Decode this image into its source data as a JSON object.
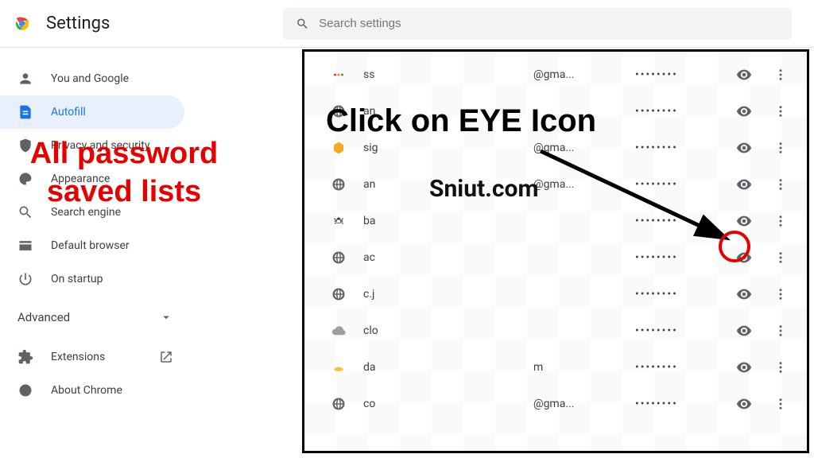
{
  "header": {
    "title": "Settings",
    "search_placeholder": "Search settings"
  },
  "sidebar": {
    "items": [
      {
        "label": "You and Google"
      },
      {
        "label": "Autofill"
      },
      {
        "label": "Privacy and security"
      },
      {
        "label": "Appearance"
      },
      {
        "label": "Search engine"
      },
      {
        "label": "Default browser"
      },
      {
        "label": "On startup"
      }
    ],
    "advanced": "Advanced",
    "extensions": "Extensions",
    "about": "About Chrome"
  },
  "passwords": [
    {
      "site": "ss",
      "user": "@gma...",
      "mask": "••••••••"
    },
    {
      "site": "an",
      "user": "",
      "mask": "••••••••"
    },
    {
      "site": "sig",
      "user": "@gma...",
      "mask": "••••••••"
    },
    {
      "site": "an",
      "user": "@gma...",
      "mask": "••••••••"
    },
    {
      "site": "ba",
      "user": "",
      "mask": "••••••••"
    },
    {
      "site": "ac",
      "user": "",
      "mask": "••••••••"
    },
    {
      "site": "c.j",
      "user": "",
      "mask": "••••••••"
    },
    {
      "site": "clo",
      "user": "",
      "mask": "••••••••"
    },
    {
      "site": "da",
      "user": "m",
      "mask": "••••••••"
    },
    {
      "site": "co",
      "user": "@gma...",
      "mask": "••••••••"
    }
  ],
  "annotations": {
    "left": "All password saved lists",
    "headline": "Click on EYE Icon",
    "site": "Sniut.com"
  }
}
